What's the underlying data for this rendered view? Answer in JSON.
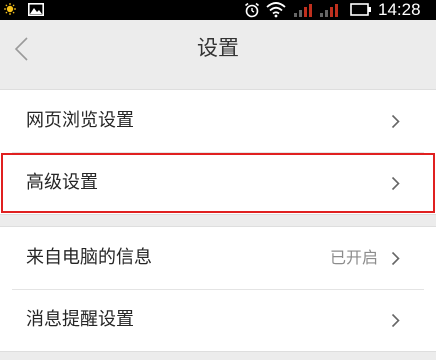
{
  "status_bar": {
    "time": "14:28",
    "icons": [
      "weather-sun-icon",
      "gallery-icon",
      "alarm-icon",
      "wifi-icon",
      "signal-icon",
      "signal-icon",
      "battery-icon"
    ]
  },
  "header": {
    "title": "设置",
    "back_icon": "back-chevron-icon"
  },
  "groups": [
    {
      "items": [
        {
          "label": "网页浏览设置",
          "value": ""
        },
        {
          "label": "高级设置",
          "value": "",
          "highlighted": true
        }
      ]
    },
    {
      "items": [
        {
          "label": "来自电脑的信息",
          "value": "已开启"
        },
        {
          "label": "消息提醒设置",
          "value": ""
        }
      ]
    }
  ],
  "colors": {
    "background": "#ececec",
    "highlight_border": "#e02020",
    "status_bar": "#000000"
  }
}
